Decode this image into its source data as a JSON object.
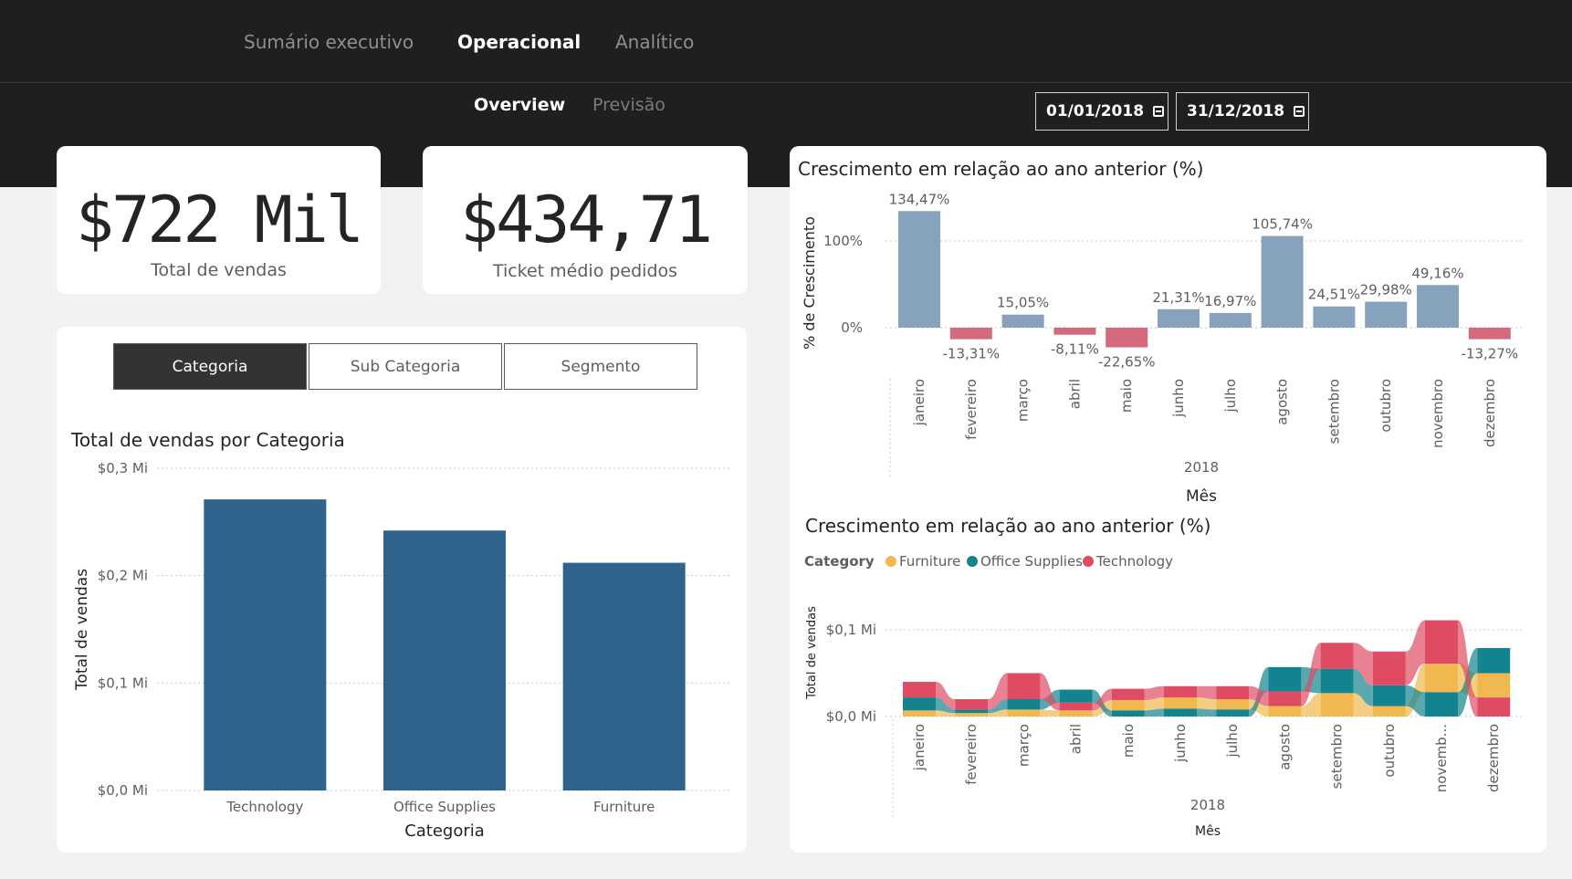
{
  "nav": {
    "tabs": [
      {
        "label": "Sumário executivo"
      },
      {
        "label": "Operacional"
      },
      {
        "label": "Analítico"
      }
    ],
    "subtabs": [
      {
        "label": "Overview"
      },
      {
        "label": "Previsão"
      }
    ]
  },
  "date_range": {
    "start": "01/01/2018",
    "end": "31/12/2018"
  },
  "kpis": {
    "total_sales": {
      "value": "$722 Mil",
      "label": "Total de vendas"
    },
    "avg_ticket": {
      "value": "$434,71",
      "label": "Ticket médio pedidos"
    }
  },
  "segment_buttons": [
    {
      "label": "Categoria",
      "active": true
    },
    {
      "label": "Sub Categoria",
      "active": false
    },
    {
      "label": "Segmento",
      "active": false
    }
  ],
  "colors": {
    "bar": "#2f638c",
    "growth_positive": "#87a2bd",
    "growth_negative": "#d46a7e",
    "furniture": "#f0b84f",
    "office_supplies": "#12838f",
    "technology": "#de4b63"
  },
  "chart_data": [
    {
      "type": "bar",
      "title": "Total de vendas por Categoria",
      "xlabel": "Categoria",
      "ylabel": "Total de vendas",
      "categories": [
        "Technology",
        "Office Supplies",
        "Furniture"
      ],
      "values": [
        0.271,
        0.242,
        0.212
      ],
      "ylim": [
        0,
        0.3
      ],
      "yticks": [
        "$0,0 Mi",
        "$0,1 Mi",
        "$0,2 Mi",
        "$0,3 Mi"
      ],
      "grid": true
    },
    {
      "type": "bar",
      "title": "Crescimento em relação ao ano anterior (%)",
      "xlabel": "Mês",
      "ylabel": "% de Crescimento",
      "x_group_label": "2018",
      "categories": [
        "janeiro",
        "fevereiro",
        "março",
        "abril",
        "maio",
        "junho",
        "julho",
        "agosto",
        "setembro",
        "outubro",
        "novembro",
        "dezembro"
      ],
      "values": [
        134.47,
        -13.31,
        15.05,
        -8.11,
        -22.65,
        21.31,
        16.97,
        105.74,
        24.51,
        29.98,
        49.16,
        -13.27
      ],
      "data_labels": [
        "134,47%",
        "-13,31%",
        "15,05%",
        "-8,11%",
        "-22,65%",
        "21,31%",
        "16,97%",
        "105,74%",
        "24,51%",
        "29,98%",
        "49,16%",
        "-13,27%"
      ],
      "yticks": [
        "0%",
        "100%"
      ],
      "ylim": [
        -30,
        140
      ],
      "grid": true
    },
    {
      "type": "area",
      "subtype": "ribbon",
      "title": "Crescimento em relação ao ano anterior (%)",
      "xlabel": "Mês",
      "ylabel": "Total de vendas",
      "x_group_label": "2018",
      "legend_title": "Category",
      "legend_position": "top-left",
      "categories": [
        "janeiro",
        "fevereiro",
        "março",
        "abril",
        "maio",
        "junho",
        "julho",
        "agosto",
        "setembro",
        "outubro",
        "novembro",
        "dezembro"
      ],
      "yticks": [
        "$0,0 Mi",
        "$0,1 Mi"
      ],
      "ylim": [
        0,
        0.12
      ],
      "series": [
        {
          "name": "Furniture",
          "values": [
            0.007,
            0.004,
            0.008,
            0.007,
            0.012,
            0.013,
            0.012,
            0.012,
            0.027,
            0.012,
            0.033,
            0.028
          ]
        },
        {
          "name": "Office Supplies",
          "values": [
            0.015,
            0.004,
            0.012,
            0.015,
            0.007,
            0.009,
            0.008,
            0.028,
            0.028,
            0.024,
            0.028,
            0.029
          ]
        },
        {
          "name": "Technology",
          "values": [
            0.018,
            0.012,
            0.03,
            0.009,
            0.013,
            0.013,
            0.015,
            0.017,
            0.03,
            0.039,
            0.05,
            0.022
          ]
        }
      ],
      "grid": true
    }
  ]
}
